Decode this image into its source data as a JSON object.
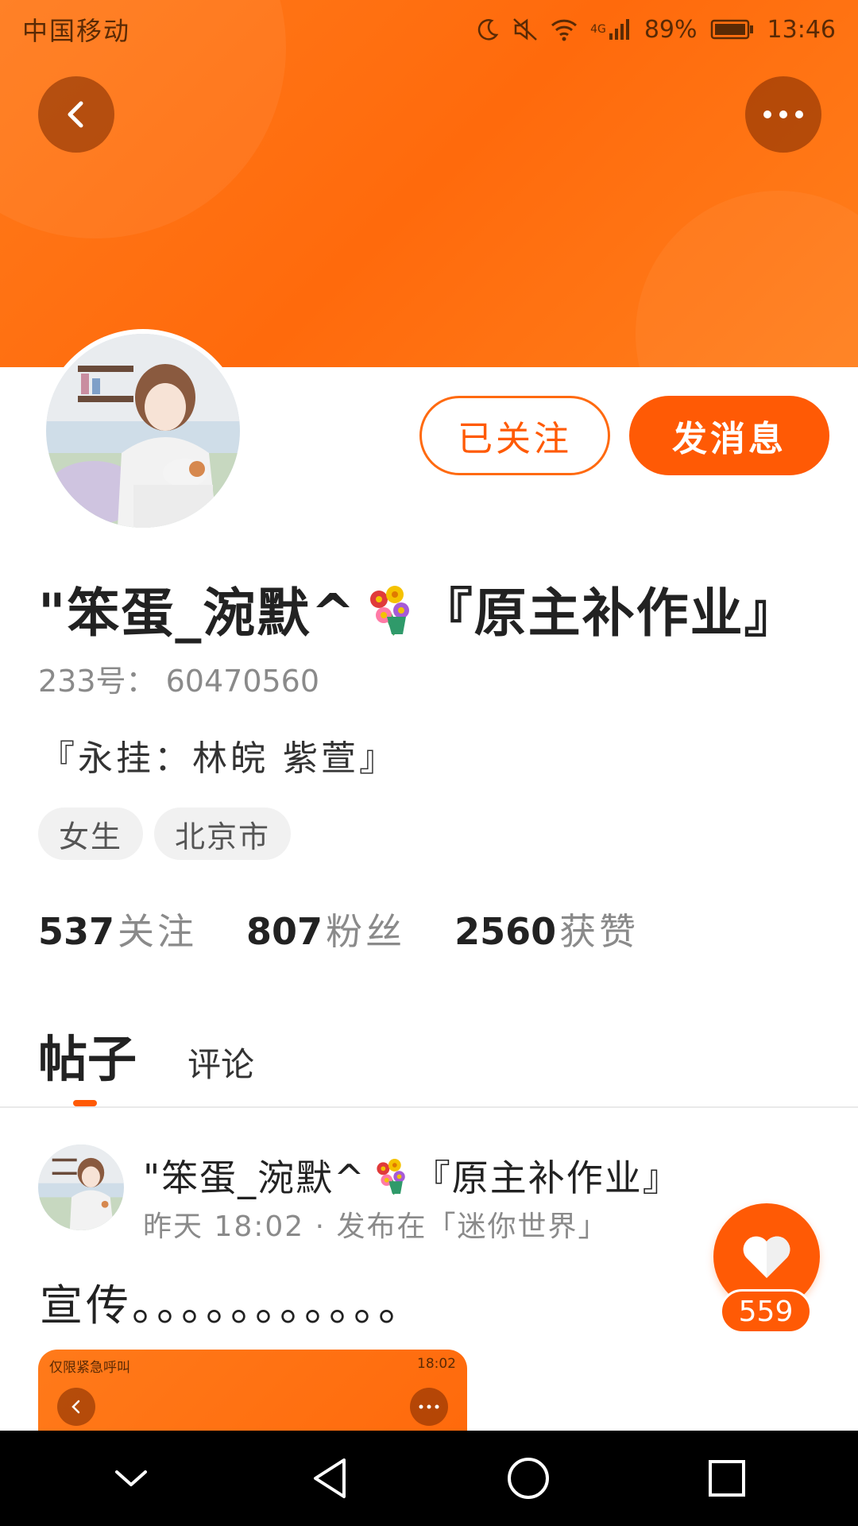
{
  "status_bar": {
    "carrier": "中国移动",
    "network": "4G",
    "battery": "89%",
    "time": "13:46"
  },
  "profile": {
    "name_prefix": "\"笨蛋_涴默^",
    "name_suffix": "『原主补作业』",
    "uid": "233号： 60470560",
    "bio": "『永挂：林皖 紫萱』",
    "tags": [
      "女生",
      "北京市"
    ],
    "stats": [
      {
        "value": "537",
        "label": "关注"
      },
      {
        "value": "807",
        "label": "粉丝"
      },
      {
        "value": "2560",
        "label": "获赞"
      }
    ]
  },
  "actions": {
    "follow_label": "已关注",
    "message_label": "发消息"
  },
  "tabs": [
    {
      "label": "帖子",
      "active": true
    },
    {
      "label": "评论",
      "active": false
    }
  ],
  "post": {
    "author_prefix": "\"笨蛋_涴默^",
    "author_suffix": "『原主补作业』",
    "meta": "昨天 18:02 · 发布在「迷你世界」",
    "text": "宣传。。。。。。。。。。。",
    "likes": "559",
    "preview": {
      "left_status": "仅限紧急呼叫",
      "right_status": "18:02"
    }
  },
  "colors": {
    "accent": "#ff5a05",
    "banner": "#ff7a1a"
  }
}
